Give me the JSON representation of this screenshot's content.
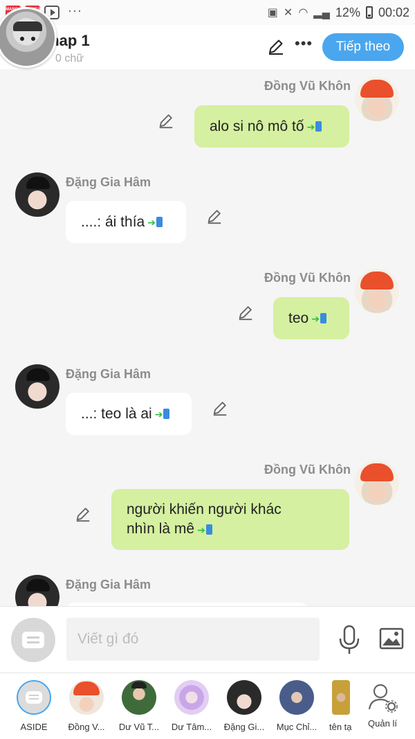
{
  "status_bar": {
    "app_badge_text": "MANGA TOON",
    "battery": "12%",
    "time": "00:02"
  },
  "header": {
    "chapter_title": "chap 1",
    "word_count": "0 chữ",
    "next_button": "Tiếp theo"
  },
  "messages": [
    {
      "sender": "Đồng Vũ Khôn",
      "side": "right",
      "text": "alo si nô mô tố"
    },
    {
      "sender": "Đặng Gia Hâm",
      "side": "left",
      "text": "....: ái thía"
    },
    {
      "sender": "Đồng Vũ Khôn",
      "side": "right",
      "text": "teo"
    },
    {
      "sender": "Đặng Gia Hâm",
      "side": "left",
      "text": "...: teo là ai"
    },
    {
      "sender": "Đồng Vũ Khôn",
      "side": "right",
      "text_line1": "người khiến người khác",
      "text_line2": "nhìn là mê"
    },
    {
      "sender": "Đặng Gia Hâm",
      "side": "left",
      "text": ""
    }
  ],
  "input": {
    "placeholder": "Viết gì đó"
  },
  "characters": [
    {
      "label": "ASIDE",
      "selected": true
    },
    {
      "label": "Đồng V..."
    },
    {
      "label": "Dư Vũ T..."
    },
    {
      "label": "Dư Tâm..."
    },
    {
      "label": "Đặng Gi..."
    },
    {
      "label": "Mục Chỉ..."
    },
    {
      "label": "tên tạ"
    },
    {
      "label": "Quản lí"
    }
  ],
  "colors": {
    "accent": "#4aa6ee",
    "my_bubble": "#d4f0a0",
    "their_bubble": "#ffffff",
    "name_gray": "#8c8c8c"
  },
  "icons": [
    "pencil-icon",
    "more-icon",
    "mic-icon",
    "image-icon",
    "compose-icon",
    "manage-user-icon"
  ]
}
